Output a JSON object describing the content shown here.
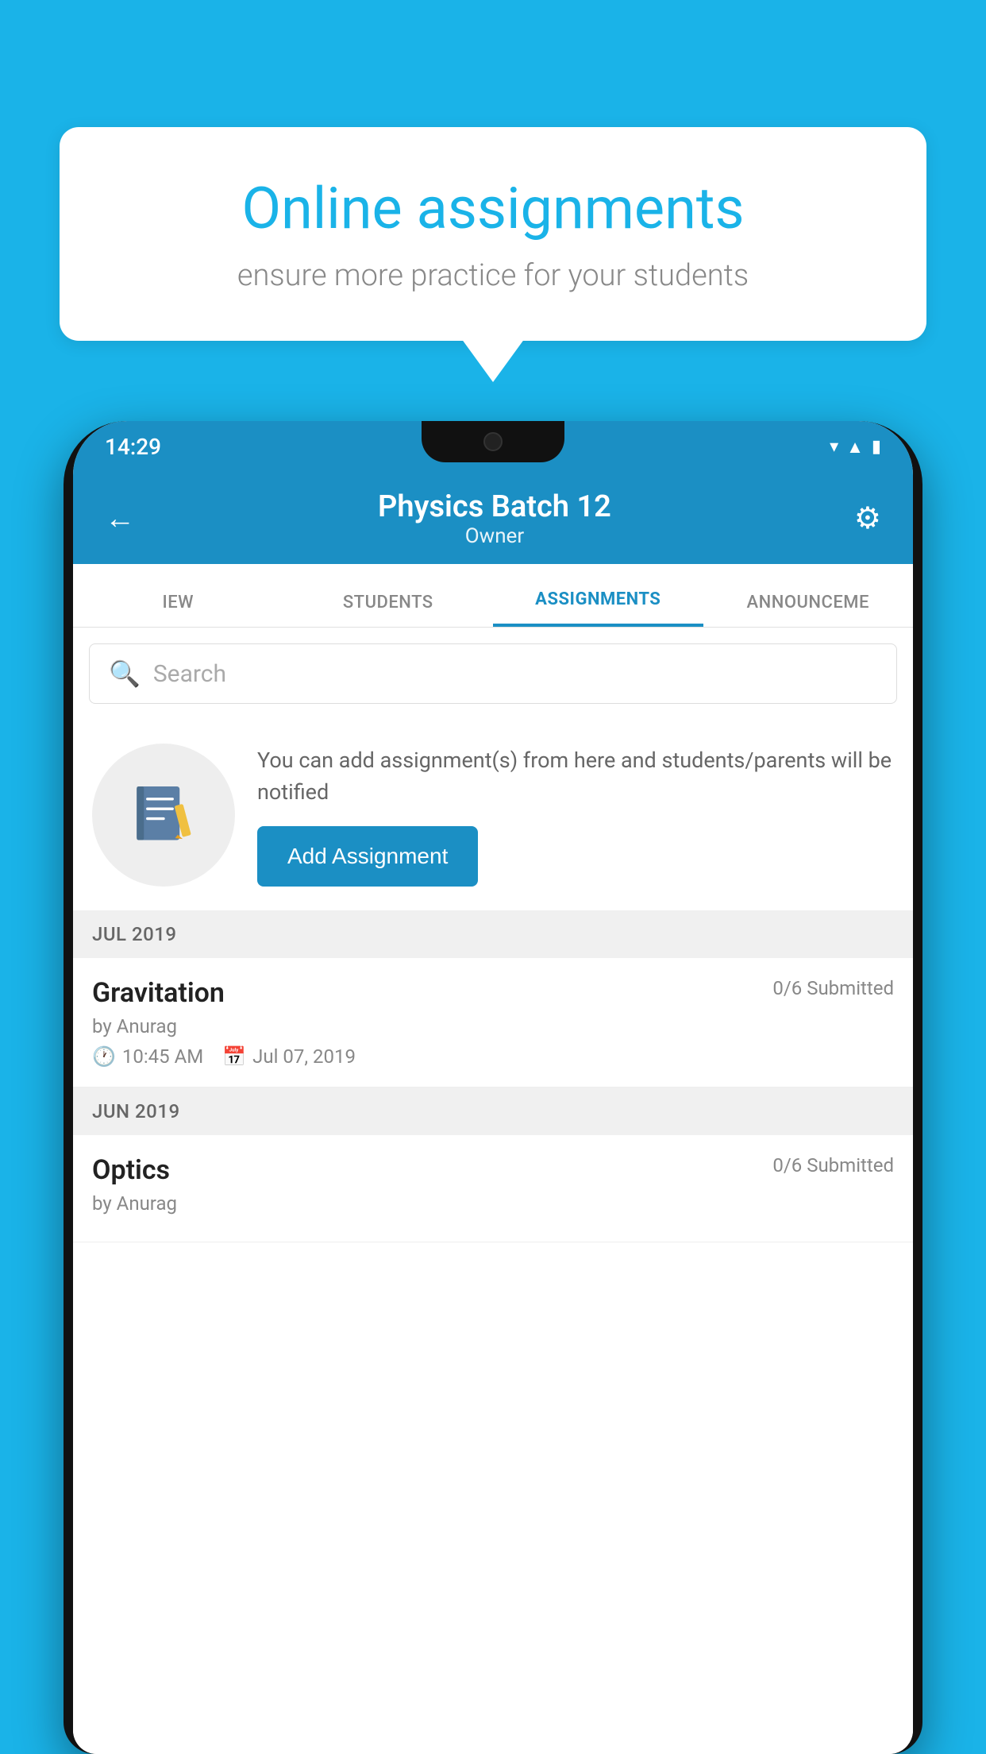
{
  "background_color": "#1ab3e8",
  "speech_bubble": {
    "title": "Online assignments",
    "subtitle": "ensure more practice for your students"
  },
  "status_bar": {
    "time": "14:29",
    "icons": [
      "wifi",
      "signal",
      "battery"
    ]
  },
  "app_header": {
    "back_label": "←",
    "title": "Physics Batch 12",
    "subtitle": "Owner",
    "settings_label": "⚙"
  },
  "tabs": [
    {
      "label": "IEW",
      "active": false
    },
    {
      "label": "STUDENTS",
      "active": false
    },
    {
      "label": "ASSIGNMENTS",
      "active": true
    },
    {
      "label": "ANNOUNCEMENTS",
      "active": false
    }
  ],
  "search": {
    "placeholder": "Search"
  },
  "empty_state": {
    "description": "You can add assignment(s) from here and students/parents will be notified",
    "button_label": "Add Assignment"
  },
  "sections": [
    {
      "header": "JUL 2019",
      "assignments": [
        {
          "name": "Gravitation",
          "submitted": "0/6 Submitted",
          "author": "by Anurag",
          "time": "10:45 AM",
          "date": "Jul 07, 2019"
        }
      ]
    },
    {
      "header": "JUN 2019",
      "assignments": [
        {
          "name": "Optics",
          "submitted": "0/6 Submitted",
          "author": "by Anurag",
          "time": "",
          "date": ""
        }
      ]
    }
  ]
}
